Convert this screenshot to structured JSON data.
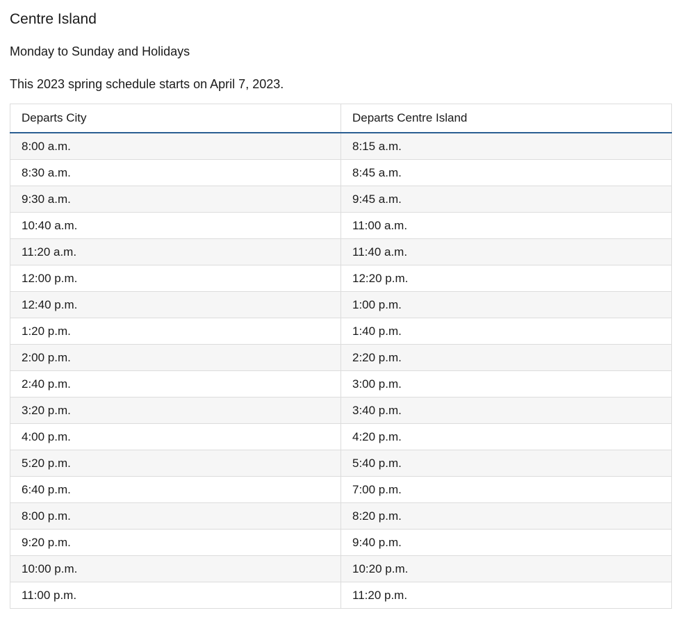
{
  "page": {
    "title": "Centre Island",
    "days": "Monday to Sunday and Holidays",
    "note": "This 2023 spring schedule starts on April 7, 2023."
  },
  "schedule": {
    "headers": [
      "Departs City",
      "Departs Centre Island"
    ],
    "rows": [
      [
        "8:00 a.m.",
        "8:15 a.m."
      ],
      [
        "8:30 a.m.",
        "8:45 a.m."
      ],
      [
        "9:30 a.m.",
        "9:45 a.m."
      ],
      [
        "10:40 a.m.",
        "11:00 a.m."
      ],
      [
        "11:20 a.m.",
        "11:40 a.m."
      ],
      [
        "12:00 p.m.",
        "12:20 p.m."
      ],
      [
        "12:40 p.m.",
        "1:00 p.m."
      ],
      [
        "1:20 p.m.",
        "1:40 p.m."
      ],
      [
        "2:00 p.m.",
        "2:20 p.m."
      ],
      [
        "2:40 p.m.",
        "3:00 p.m."
      ],
      [
        "3:20 p.m.",
        "3:40 p.m."
      ],
      [
        "4:00 p.m.",
        "4:20 p.m."
      ],
      [
        "5:20 p.m.",
        "5:40 p.m."
      ],
      [
        "6:40 p.m.",
        "7:00 p.m."
      ],
      [
        "8:00 p.m.",
        "8:20 p.m."
      ],
      [
        "9:20 p.m.",
        "9:40 p.m."
      ],
      [
        "10:00 p.m.",
        "10:20 p.m."
      ],
      [
        "11:00 p.m.",
        "11:20 p.m."
      ]
    ]
  }
}
